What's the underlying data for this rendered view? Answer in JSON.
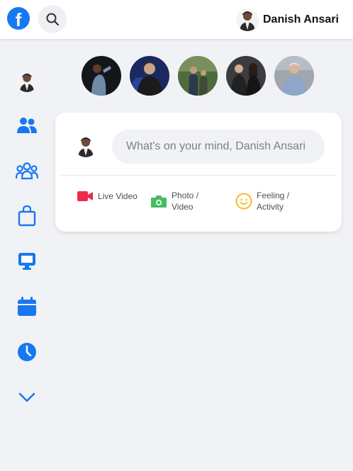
{
  "header": {
    "logo_letter": "f",
    "profile_name": "Danish Ansari"
  },
  "composer": {
    "placeholder": "What's on your mind, Danish Ansari",
    "actions": [
      {
        "label": "Live Video",
        "icon": "video-camera-icon",
        "color": "#f02849"
      },
      {
        "label": "Photo / Video",
        "icon": "camera-icon",
        "color": "#45bd62"
      },
      {
        "label": "Feeling / Activity",
        "icon": "smiley-icon",
        "color": "#f7b928"
      }
    ]
  },
  "sidebar": {
    "items": [
      {
        "icon": "profile-avatar-icon"
      },
      {
        "icon": "friends-icon"
      },
      {
        "icon": "groups-icon"
      },
      {
        "icon": "marketplace-bag-icon"
      },
      {
        "icon": "watch-monitor-icon"
      },
      {
        "icon": "events-calendar-icon"
      },
      {
        "icon": "memories-clock-icon"
      },
      {
        "icon": "see-more-chevron-icon"
      }
    ]
  },
  "stories": [
    {
      "icon": "story-avatar"
    },
    {
      "icon": "story-avatar"
    },
    {
      "icon": "story-avatar"
    },
    {
      "icon": "story-avatar"
    },
    {
      "icon": "story-avatar"
    }
  ],
  "colors": {
    "accent": "#1877f2",
    "background": "#f1f2f5",
    "card": "#ffffff"
  }
}
